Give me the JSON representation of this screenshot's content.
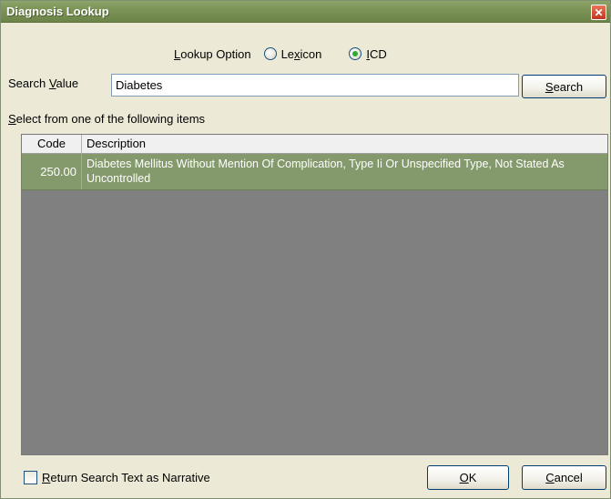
{
  "window": {
    "title": "Diagnosis Lookup",
    "close_glyph": "✕"
  },
  "lookup_option": {
    "label": "Lookup Option",
    "options": [
      {
        "label": "Lexicon",
        "selected": false
      },
      {
        "label": "ICD",
        "selected": true
      }
    ]
  },
  "search": {
    "label": "Search Value",
    "value": "Diabetes",
    "button_label": "Search"
  },
  "results": {
    "instruction": "Select from one of the following items",
    "columns": [
      "Code",
      "Description"
    ],
    "rows": [
      {
        "code": "250.00",
        "description": "Diabetes Mellitus Without Mention Of Complication, Type Ii Or Unspecified Type, Not Stated As Uncontrolled",
        "selected": true
      }
    ]
  },
  "footer": {
    "narrative_label": "Return Search Text as Narrative",
    "narrative_checked": false,
    "ok_label": "OK",
    "cancel_label": "Cancel"
  },
  "colors": {
    "title_bar": "#7b9256",
    "selected_row": "#849a6c",
    "grid_empty": "#808080",
    "dialog_bg": "#ecead7"
  }
}
